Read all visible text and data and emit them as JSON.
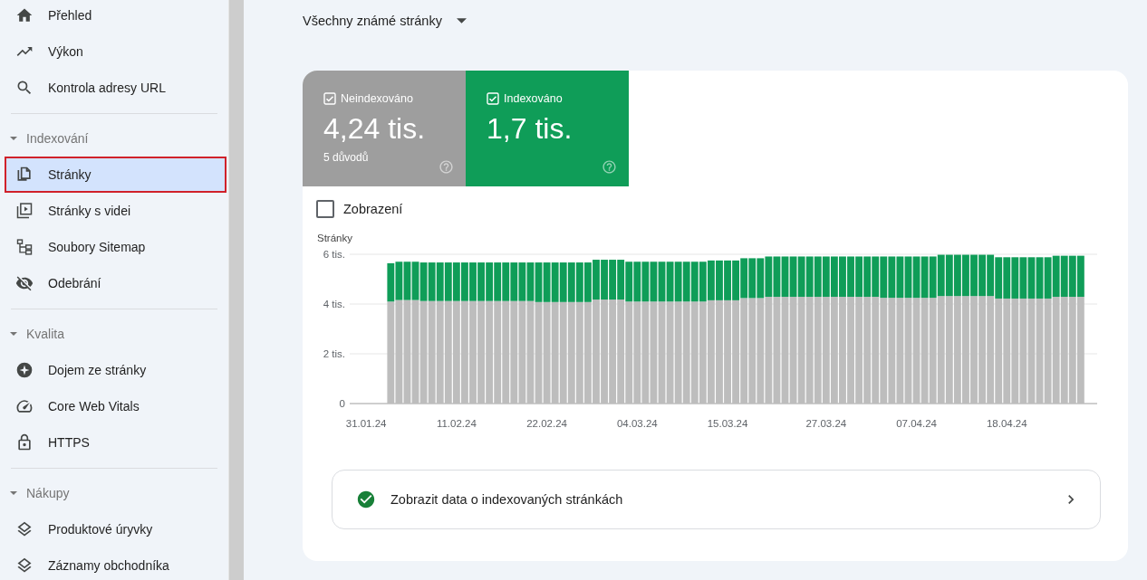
{
  "sidebar": {
    "items": [
      {
        "label": "Přehled",
        "selected": false
      },
      {
        "label": "Výkon",
        "selected": false
      },
      {
        "label": "Kontrola adresy URL",
        "selected": false
      }
    ],
    "sections": [
      {
        "title": "Indexování",
        "expanded": true,
        "items": [
          {
            "label": "Stránky",
            "selected": true
          },
          {
            "label": "Stránky s videi",
            "selected": false
          },
          {
            "label": "Soubory Sitemap",
            "selected": false
          },
          {
            "label": "Odebrání",
            "selected": false
          }
        ]
      },
      {
        "title": "Kvalita",
        "expanded": true,
        "items": [
          {
            "label": "Dojem ze stránky",
            "selected": false
          },
          {
            "label": "Core Web Vitals",
            "selected": false
          },
          {
            "label": "HTTPS",
            "selected": false
          }
        ]
      },
      {
        "title": "Nákupy",
        "expanded": true,
        "items": [
          {
            "label": "Produktové úryvky",
            "selected": false
          },
          {
            "label": "Záznamy obchodníka",
            "selected": false
          }
        ]
      }
    ]
  },
  "filter": {
    "value": "Všechny známé stránky"
  },
  "tiles": [
    {
      "label": "Neindexováno",
      "value": "4,24 tis.",
      "note": "5 důvodů",
      "checked": true,
      "color": "#9e9e9e"
    },
    {
      "label": "Indexováno",
      "value": "1,7 tis.",
      "checked": true,
      "color": "#0f9d58"
    }
  ],
  "impressions": {
    "label": "Zobrazení",
    "checked": false
  },
  "chart": {
    "chart_data": {
      "type": "bar",
      "stacked": true,
      "ylabel": "Stránky",
      "ylim": [
        0,
        6
      ],
      "yticks": [
        {
          "value": 0,
          "label": "0"
        },
        {
          "value": 2,
          "label": "2 tis."
        },
        {
          "value": 4,
          "label": "4 tis."
        },
        {
          "value": 6,
          "label": "6 tis."
        }
      ],
      "categories": [
        "31.01.24",
        null,
        null,
        null,
        null,
        null,
        null,
        null,
        null,
        null,
        null,
        "11.02.24",
        null,
        null,
        null,
        null,
        null,
        null,
        null,
        null,
        null,
        null,
        "22.02.24",
        null,
        null,
        null,
        null,
        null,
        null,
        null,
        null,
        null,
        null,
        "04.03.24",
        null,
        null,
        null,
        null,
        null,
        null,
        null,
        null,
        null,
        null,
        "15.03.24",
        null,
        null,
        null,
        null,
        null,
        null,
        null,
        null,
        null,
        null,
        null,
        "27.03.24",
        null,
        null,
        null,
        null,
        null,
        null,
        null,
        null,
        null,
        null,
        "07.04.24",
        null,
        null,
        null,
        null,
        null,
        null,
        null,
        null,
        null,
        null,
        "18.04.24",
        null,
        null,
        null,
        null,
        null,
        null,
        null,
        null,
        null
      ],
      "series": [
        {
          "color": "#bdbdbd",
          "values": [
            null,
            null,
            null,
            4.1,
            4.16,
            4.16,
            4.16,
            4.12,
            4.12,
            4.12,
            4.12,
            4.12,
            4.12,
            4.12,
            4.12,
            4.12,
            4.12,
            4.12,
            4.12,
            4.12,
            4.12,
            4.08,
            4.08,
            4.08,
            4.08,
            4.08,
            4.08,
            4.08,
            4.18,
            4.18,
            4.18,
            4.18,
            4.1,
            4.1,
            4.1,
            4.1,
            4.1,
            4.1,
            4.1,
            4.1,
            4.1,
            4.1,
            4.15,
            4.15,
            4.15,
            4.15,
            4.24,
            4.24,
            4.24,
            4.29,
            4.29,
            4.29,
            4.29,
            4.29,
            4.29,
            4.29,
            4.29,
            4.29,
            4.29,
            4.29,
            4.29,
            4.29,
            4.29,
            4.25,
            4.25,
            4.25,
            4.25,
            4.25,
            4.25,
            4.25,
            4.32,
            4.32,
            4.32,
            4.32,
            4.32,
            4.32,
            4.32,
            4.22,
            4.22,
            4.22,
            4.22,
            4.22,
            4.22,
            4.22,
            4.29,
            4.29,
            4.29,
            4.29
          ]
        },
        {
          "color": "#0f9d58",
          "values": [
            null,
            null,
            null,
            1.54,
            1.54,
            1.54,
            1.54,
            1.55,
            1.55,
            1.55,
            1.55,
            1.55,
            1.55,
            1.55,
            1.55,
            1.55,
            1.55,
            1.55,
            1.55,
            1.55,
            1.55,
            1.59,
            1.59,
            1.59,
            1.59,
            1.59,
            1.59,
            1.59,
            1.6,
            1.6,
            1.6,
            1.6,
            1.6,
            1.6,
            1.6,
            1.6,
            1.6,
            1.6,
            1.6,
            1.6,
            1.6,
            1.6,
            1.6,
            1.6,
            1.6,
            1.6,
            1.6,
            1.6,
            1.6,
            1.62,
            1.62,
            1.62,
            1.62,
            1.62,
            1.62,
            1.62,
            1.62,
            1.62,
            1.62,
            1.62,
            1.62,
            1.62,
            1.62,
            1.66,
            1.66,
            1.66,
            1.66,
            1.66,
            1.66,
            1.66,
            1.66,
            1.66,
            1.66,
            1.66,
            1.66,
            1.66,
            1.66,
            1.66,
            1.66,
            1.66,
            1.66,
            1.66,
            1.66,
            1.66,
            1.65,
            1.65,
            1.65,
            1.65
          ]
        }
      ]
    }
  },
  "details_link": {
    "label": "Zobrazit data o indexovaných stránkách"
  }
}
